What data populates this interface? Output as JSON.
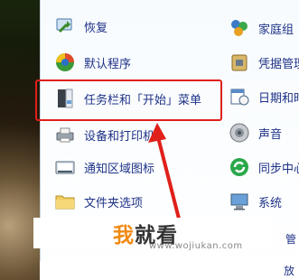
{
  "control_panel": {
    "left_column": [
      {
        "label": "恢复",
        "icon": "restore-icon"
      },
      {
        "label": "默认程序",
        "icon": "default-programs-icon"
      },
      {
        "label": "任务栏和「开始」菜单",
        "icon": "taskbar-icon"
      },
      {
        "label": "设备和打印机",
        "icon": "printer-icon"
      },
      {
        "label": "通知区域图标",
        "icon": "notification-area-icon"
      },
      {
        "label": "文件夹选项",
        "icon": "folder-icon"
      }
    ],
    "right_column": [
      {
        "label": "家庭组",
        "icon": "homegroup-icon"
      },
      {
        "label": "凭据管理",
        "icon": "credential-icon"
      },
      {
        "label": "日期和时",
        "icon": "date-time-icon"
      },
      {
        "label": "声音",
        "icon": "sound-icon"
      },
      {
        "label": "同步中心",
        "icon": "sync-center-icon"
      },
      {
        "label": "系统",
        "icon": "system-icon"
      }
    ],
    "partial_right_labels": [
      "管",
      "放"
    ]
  },
  "watermark": {
    "logo_orange": "我",
    "logo_dark": "就看",
    "url": "www.wojiukan.com"
  },
  "colors": {
    "highlight_border": "#e0201a",
    "link_text": "#1e3287",
    "logo_orange": "#f08a14"
  }
}
